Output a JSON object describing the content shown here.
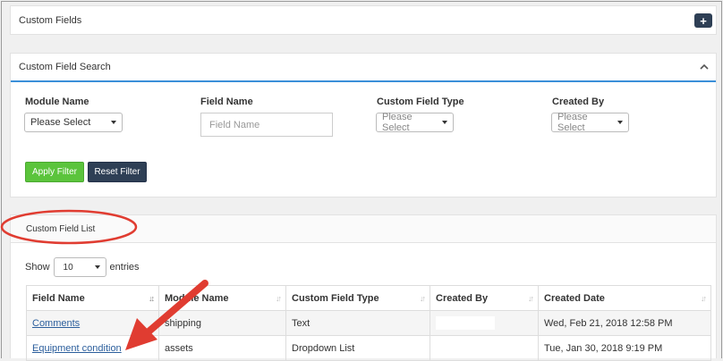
{
  "custom_fields_panel": {
    "title": "Custom Fields",
    "add_icon": "plus-icon",
    "add_glyph": "+"
  },
  "search_panel": {
    "title": "Custom Field Search",
    "collapse_icon": "chevron-up-icon",
    "module_name": {
      "label": "Module Name",
      "value": "Please Select"
    },
    "field_name": {
      "label": "Field Name",
      "placeholder": "Field Name"
    },
    "custom_field_type": {
      "label": "Custom Field Type",
      "value": "Please Select"
    },
    "created_by": {
      "label": "Created By",
      "value": "Please Select"
    },
    "apply_label": "Apply Filter",
    "reset_label": "Reset Filter",
    "apply_color": "#5bc43c",
    "reset_color": "#2e3f55"
  },
  "list_panel": {
    "title": "Custom Field List",
    "show_label": "Show",
    "entries_value": "10",
    "entries_label": "entries",
    "columns": [
      "Field Name",
      "Module Name",
      "Custom Field Type",
      "Created By",
      "Created Date"
    ],
    "rows": [
      {
        "field_name": "Comments",
        "module": "shipping",
        "type": "Text",
        "created_by": "",
        "created_date": "Wed, Feb 21, 2018 12:58 PM"
      },
      {
        "field_name": "Equipment condition",
        "module": "assets",
        "type": "Dropdown List",
        "created_by": "",
        "created_date": "Tue, Jan 30, 2018 9:19 PM"
      }
    ]
  },
  "annotations": {
    "highlight_color": "#e03c31"
  }
}
